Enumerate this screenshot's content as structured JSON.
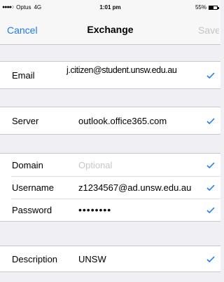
{
  "status_bar": {
    "carrier": "Optus",
    "network": "4G",
    "time": "1:01 pm",
    "battery": "55%"
  },
  "nav": {
    "cancel_label": "Cancel",
    "title": "Exchange",
    "save_label": "Save"
  },
  "account": {
    "email_label": "Email",
    "email_value": "j.citizen@student.unsw.edu.au",
    "server_label": "Server",
    "server_value": "outlook.office365.com",
    "domain_label": "Domain",
    "domain_placeholder": "Optional",
    "username_label": "Username",
    "username_value": "z1234567@ad.unsw.edu.au",
    "password_label": "Password",
    "password_value": "••••••••",
    "description_label": "Description",
    "description_value": "UNSW"
  },
  "colors": {
    "accent": "#2079f2",
    "background": "#efeff4",
    "disabled": "#c4c4c4",
    "placeholder": "#c7c7cd"
  },
  "icons": [
    "signal-dots-icon",
    "battery-icon",
    "checkmark-icon"
  ]
}
